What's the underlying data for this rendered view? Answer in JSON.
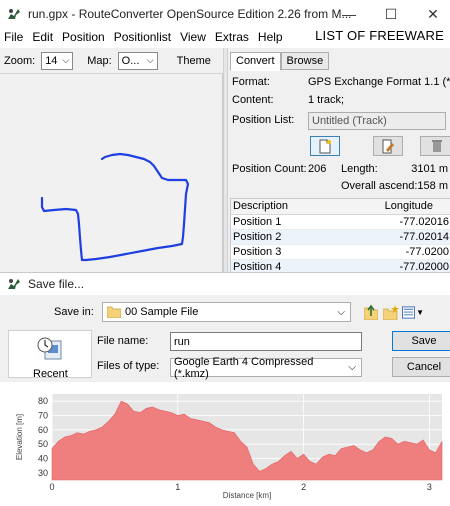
{
  "window": {
    "title": "run.gpx - RouteConverter OpenSource Edition 2.26 from M...",
    "min_glyph": "—",
    "max_glyph": "☐",
    "close_glyph": "✕"
  },
  "menu": [
    "File",
    "Edit",
    "Position",
    "Positionlist",
    "View",
    "Extras",
    "Help"
  ],
  "watermark": "LIST OF FREEWARE",
  "map_toolbar": {
    "zoom_label": "Zoom:",
    "zoom_value": "14",
    "map_label": "Map:",
    "map_value": "O...",
    "theme_label": "Theme"
  },
  "tabs": [
    "Convert",
    "Browse"
  ],
  "info": {
    "format_label": "Format:",
    "format_value": "GPS Exchange Format 1.1 (*.gpx)",
    "content_label": "Content:",
    "content_value": "1 track;",
    "position_list_label": "Position List:",
    "position_list_value": "Untitled (Track)",
    "position_count_label": "Position Count:",
    "position_count_value": "206",
    "length_label": "Length:",
    "length_value": "3101 m",
    "ascend_label": "Overall ascend:",
    "ascend_value": "158 m"
  },
  "table": {
    "headers": [
      "Description",
      "Longitude"
    ],
    "rows": [
      [
        "Position 1",
        "-77.02016"
      ],
      [
        "Position 2",
        "-77.02014"
      ],
      [
        "Position 3",
        "-77.0200"
      ],
      [
        "Position 4",
        "-77.02000"
      ]
    ]
  },
  "dialog": {
    "title": "Save file...",
    "save_in_label": "Save in:",
    "save_in_value": "00 Sample File",
    "recent_label": "Recent",
    "file_name_label": "File name:",
    "file_name_value": "run",
    "files_of_type_label": "Files of type:",
    "files_of_type_value": "Google Earth 4 Compressed (*.kmz)",
    "save_button": "Save",
    "cancel_button": "Cancel"
  },
  "colors": {
    "route": "#1f3fe0",
    "elevation_fill": "#ef7f7f",
    "chart_bg": "#e6e6e6"
  },
  "chart_data": {
    "type": "area",
    "xlabel": "Distance [km]",
    "ylabel": "Elevation [m]",
    "xlim": [
      0,
      3.1
    ],
    "ylim": [
      25,
      85
    ],
    "xticks": [
      0,
      1,
      2,
      3
    ],
    "yticks": [
      30,
      40,
      50,
      60,
      70,
      80
    ],
    "grid": true,
    "x": [
      0,
      0.05,
      0.1,
      0.15,
      0.2,
      0.25,
      0.3,
      0.35,
      0.4,
      0.45,
      0.5,
      0.55,
      0.6,
      0.65,
      0.7,
      0.75,
      0.8,
      0.85,
      0.9,
      0.95,
      1.0,
      1.05,
      1.1,
      1.15,
      1.2,
      1.25,
      1.3,
      1.35,
      1.4,
      1.45,
      1.5,
      1.55,
      1.6,
      1.65,
      1.7,
      1.75,
      1.8,
      1.85,
      1.9,
      1.95,
      2.0,
      2.05,
      2.1,
      2.15,
      2.2,
      2.25,
      2.3,
      2.35,
      2.4,
      2.45,
      2.5,
      2.55,
      2.6,
      2.65,
      2.7,
      2.75,
      2.8,
      2.85,
      2.9,
      2.95,
      3.0,
      3.05,
      3.1
    ],
    "values": [
      47,
      52,
      55,
      56,
      58,
      57,
      59,
      60,
      62,
      66,
      71,
      80,
      78,
      73,
      72,
      75,
      76,
      74,
      73,
      72,
      70,
      71,
      68,
      67,
      66,
      65,
      62,
      60,
      59,
      58,
      52,
      48,
      36,
      31,
      33,
      36,
      38,
      42,
      45,
      40,
      43,
      38,
      36,
      41,
      43,
      42,
      47,
      48,
      49,
      46,
      44,
      46,
      52,
      55,
      54,
      50,
      52,
      51,
      50,
      53,
      46,
      44,
      52
    ]
  }
}
